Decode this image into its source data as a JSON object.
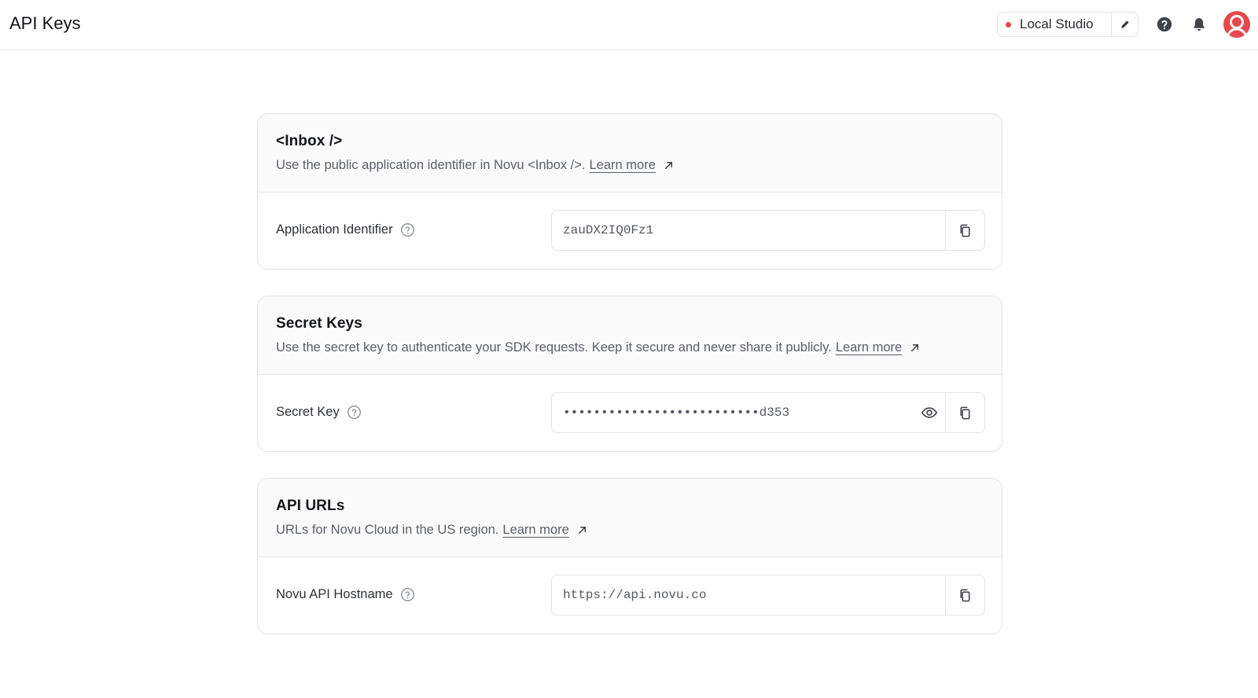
{
  "header": {
    "title": "API Keys",
    "environment": {
      "label": "Local Studio",
      "dot_color": "#e5484d"
    }
  },
  "icons": {
    "edit": "pencil-icon",
    "help": "question-circle-icon",
    "notifications": "bell-icon",
    "avatar": "user-avatar-icon",
    "copy": "copy-icon",
    "reveal": "eye-icon",
    "external": "arrow-up-right-icon"
  },
  "sections": {
    "inbox": {
      "title": "<Inbox />",
      "description": "Use the public application identifier in Novu <Inbox />.",
      "link": "Learn more",
      "field_label": "Application Identifier",
      "field_value": "zauDX2IQ0Fz1"
    },
    "secret": {
      "title": "Secret Keys",
      "description": "Use the secret key to authenticate your SDK requests. Keep it secure and never share it publicly.",
      "link": "Learn more",
      "field_label": "Secret Key",
      "field_value": "••••••••••••••••••••••••••d353"
    },
    "urls": {
      "title": "API URLs",
      "description": "URLs for Novu Cloud in the US region.",
      "link": "Learn more",
      "field_label": "Novu API Hostname",
      "field_value": "https://api.novu.co"
    }
  },
  "colors": {
    "accent_red": "#e5484d",
    "text_muted": "#5b5f68",
    "border": "#e3e4e8"
  }
}
